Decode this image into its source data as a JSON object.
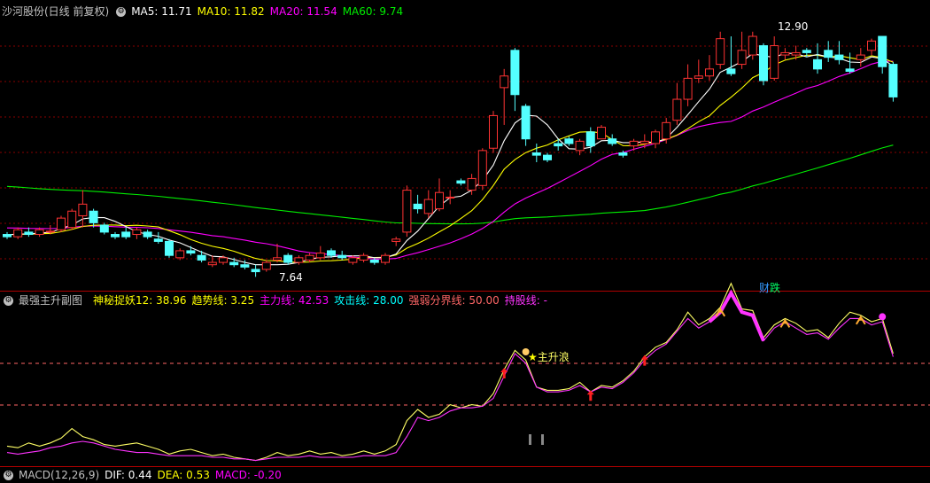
{
  "colors": {
    "up": "#ff3333",
    "down": "#54ffff",
    "ma5": "#ffffff",
    "ma10": "#ffff00",
    "ma20": "#ff00ff",
    "ma60": "#00ee00",
    "grid": "#8a0000",
    "line1": "#ffff66",
    "line2": "#ff33ff"
  },
  "main_panel": {
    "title": "沙河股份(日线 前复权)",
    "gear_icon": "gear-icon",
    "ma": [
      {
        "label": "MA5: 11.71",
        "color": "#ffffff"
      },
      {
        "label": "MA10: 11.82",
        "color": "#ffff00"
      },
      {
        "label": "MA20: 11.54",
        "color": "#ff00ff"
      },
      {
        "label": "MA60: 9.74",
        "color": "#00ee00"
      }
    ],
    "high_label": "12.90",
    "low_label": "7.64",
    "tags": [
      {
        "text": "财",
        "color": "#3399ff"
      },
      {
        "text": "跌",
        "color": "#00ff66"
      }
    ]
  },
  "sub_panel": {
    "title": "最强主升副图",
    "items": [
      {
        "label": "神秘捉妖12: 38.96",
        "color": "#ffff00"
      },
      {
        "label": "趋势线: 3.25",
        "color": "#ffff00"
      },
      {
        "label": "主力线: 42.53",
        "color": "#ff00ff"
      },
      {
        "label": "攻击线: 28.00",
        "color": "#00ffff"
      },
      {
        "label": "强弱分界线: 50.00",
        "color": "#ff6666"
      },
      {
        "label": "持股线: -",
        "color": "#ff33ff"
      }
    ],
    "annotation": "主升浪",
    "star_icon": "star-icon"
  },
  "macd_panel": {
    "title": "MACD(12,26,9)",
    "dif": "DIF: 0.44",
    "dea": "DEA: 0.53",
    "macd": "MACD: -0.20"
  },
  "chart_data": [
    {
      "type": "candlestick",
      "title": "沙河股份(日线 前复权)",
      "ylim": [
        7.4,
        13.2
      ],
      "candles": [
        [
          8.55,
          8.6,
          8.45,
          8.5
        ],
        [
          8.5,
          8.7,
          8.45,
          8.65
        ],
        [
          8.6,
          8.7,
          8.5,
          8.55
        ],
        [
          8.55,
          8.7,
          8.5,
          8.65
        ],
        [
          8.6,
          8.75,
          8.55,
          8.62
        ],
        [
          8.65,
          8.95,
          8.6,
          8.9
        ],
        [
          8.7,
          9.1,
          8.65,
          9.05
        ],
        [
          8.95,
          9.5,
          8.7,
          9.2
        ],
        [
          9.05,
          9.1,
          8.7,
          8.8
        ],
        [
          8.75,
          8.8,
          8.55,
          8.6
        ],
        [
          8.55,
          8.6,
          8.45,
          8.5
        ],
        [
          8.6,
          8.7,
          8.45,
          8.5
        ],
        [
          8.55,
          8.7,
          8.45,
          8.65
        ],
        [
          8.6,
          8.65,
          8.45,
          8.5
        ],
        [
          8.45,
          8.6,
          8.35,
          8.4
        ],
        [
          8.4,
          8.45,
          8.05,
          8.1
        ],
        [
          8.05,
          8.25,
          8.0,
          8.2
        ],
        [
          8.2,
          8.3,
          8.1,
          8.15
        ],
        [
          8.1,
          8.2,
          7.95,
          8.0
        ],
        [
          7.9,
          8.1,
          7.85,
          7.95
        ],
        [
          7.95,
          8.1,
          7.9,
          8.05
        ],
        [
          7.95,
          8.05,
          7.85,
          7.9
        ],
        [
          7.9,
          8.0,
          7.8,
          7.85
        ],
        [
          7.8,
          7.9,
          7.64,
          7.75
        ],
        [
          7.8,
          8.0,
          7.75,
          7.95
        ],
        [
          8.0,
          8.35,
          7.95,
          8.05
        ],
        [
          8.1,
          8.15,
          7.9,
          7.95
        ],
        [
          7.95,
          8.1,
          7.9,
          8.05
        ],
        [
          8.0,
          8.15,
          7.95,
          8.1
        ],
        [
          8.05,
          8.3,
          8.0,
          8.15
        ],
        [
          8.2,
          8.25,
          8.05,
          8.1
        ],
        [
          8.1,
          8.2,
          8.0,
          8.05
        ],
        [
          7.95,
          8.1,
          7.9,
          8.05
        ],
        [
          8.0,
          8.15,
          7.95,
          8.1
        ],
        [
          8.0,
          8.05,
          7.9,
          7.95
        ],
        [
          7.95,
          8.15,
          7.9,
          8.1
        ],
        [
          8.4,
          8.5,
          8.3,
          8.45
        ],
        [
          8.6,
          9.6,
          8.5,
          9.5
        ],
        [
          9.2,
          9.4,
          9.0,
          9.1
        ],
        [
          9.0,
          9.5,
          8.9,
          9.3
        ],
        [
          9.1,
          9.75,
          9.05,
          9.45
        ],
        [
          9.35,
          9.5,
          9.2,
          9.35
        ],
        [
          9.7,
          9.75,
          9.6,
          9.65
        ],
        [
          9.5,
          9.85,
          9.4,
          9.75
        ],
        [
          9.6,
          10.4,
          9.5,
          10.35
        ],
        [
          10.4,
          11.2,
          10.3,
          11.1
        ],
        [
          11.7,
          12.1,
          10.9,
          11.95
        ],
        [
          12.5,
          12.55,
          11.2,
          11.55
        ],
        [
          11.3,
          11.35,
          10.45,
          10.6
        ],
        [
          10.3,
          10.5,
          10.1,
          10.25
        ],
        [
          10.25,
          10.3,
          10.1,
          10.15
        ],
        [
          10.5,
          10.6,
          10.35,
          10.45
        ],
        [
          10.6,
          10.65,
          10.45,
          10.5
        ],
        [
          10.35,
          10.6,
          10.25,
          10.55
        ],
        [
          10.75,
          10.85,
          10.3,
          10.45
        ],
        [
          10.6,
          10.9,
          10.6,
          10.85
        ],
        [
          10.6,
          10.7,
          10.45,
          10.5
        ],
        [
          10.3,
          10.35,
          10.2,
          10.25
        ],
        [
          10.45,
          10.6,
          10.35,
          10.55
        ],
        [
          10.5,
          10.7,
          10.4,
          10.55
        ],
        [
          10.5,
          10.8,
          10.4,
          10.75
        ],
        [
          10.6,
          11.05,
          10.5,
          10.95
        ],
        [
          11.0,
          11.8,
          10.9,
          11.45
        ],
        [
          11.45,
          12.2,
          11.3,
          11.9
        ],
        [
          11.9,
          12.3,
          11.8,
          11.95
        ],
        [
          11.95,
          12.4,
          11.85,
          12.1
        ],
        [
          12.2,
          12.9,
          12.1,
          12.75
        ],
        [
          12.1,
          12.8,
          11.95,
          12.0
        ],
        [
          12.2,
          12.9,
          12.1,
          12.5
        ],
        [
          12.4,
          12.9,
          12.3,
          12.8
        ],
        [
          12.6,
          12.65,
          11.75,
          11.85
        ],
        [
          11.9,
          12.8,
          11.85,
          12.6
        ],
        [
          12.4,
          12.55,
          12.3,
          12.45
        ],
        [
          12.4,
          12.6,
          12.3,
          12.45
        ],
        [
          12.5,
          12.55,
          12.35,
          12.45
        ],
        [
          12.3,
          12.65,
          12.0,
          12.1
        ],
        [
          12.5,
          12.7,
          12.25,
          12.35
        ],
        [
          12.4,
          12.7,
          12.2,
          12.3
        ],
        [
          12.1,
          12.45,
          12.0,
          12.05
        ],
        [
          12.3,
          12.55,
          12.15,
          12.4
        ],
        [
          12.5,
          12.75,
          12.4,
          12.7
        ],
        [
          12.8,
          12.8,
          12.0,
          12.15
        ],
        [
          12.2,
          12.25,
          11.4,
          11.5
        ]
      ]
    },
    {
      "type": "line",
      "title": "最强主升副图",
      "ylim": [
        0,
        100
      ],
      "series": [
        {
          "name": "神秘捉妖12",
          "values": [
            12,
            11,
            14,
            12,
            14,
            17,
            23,
            18,
            16,
            13,
            12,
            13,
            14,
            12,
            10,
            7,
            9,
            10,
            8,
            6,
            7,
            5,
            4,
            3,
            5,
            8,
            6,
            7,
            9,
            7,
            8,
            6,
            7,
            9,
            7,
            9,
            13,
            28,
            35,
            30,
            32,
            38,
            36,
            38,
            37,
            45,
            60,
            72,
            66,
            49,
            47,
            47,
            48,
            52,
            46,
            50,
            49,
            53,
            59,
            68,
            74,
            77,
            85,
            96,
            88,
            92,
            99,
            114,
            98,
            97,
            80,
            88,
            92,
            89,
            84,
            85,
            80,
            89,
            96,
            94,
            90,
            92,
            70
          ]
        },
        {
          "name": "主力线",
          "values": [
            8,
            7,
            8,
            9,
            11,
            12,
            14,
            15,
            14,
            12,
            10,
            9,
            8,
            8,
            7,
            6,
            6,
            6,
            6,
            5,
            5,
            4,
            4,
            3,
            4,
            5,
            5,
            5,
            6,
            5,
            5,
            5,
            5,
            6,
            6,
            6,
            8,
            18,
            30,
            28,
            30,
            34,
            36,
            36,
            37,
            42,
            56,
            70,
            64,
            49,
            46,
            46,
            47,
            50,
            46,
            49,
            48,
            52,
            58,
            66,
            72,
            76,
            84,
            92,
            86,
            90,
            96,
            108,
            96,
            94,
            78,
            86,
            90,
            86,
            82,
            83,
            79,
            86,
            92,
            92,
            88,
            90,
            68
          ]
        }
      ],
      "reference_lines": [
        70,
        20
      ]
    }
  ]
}
